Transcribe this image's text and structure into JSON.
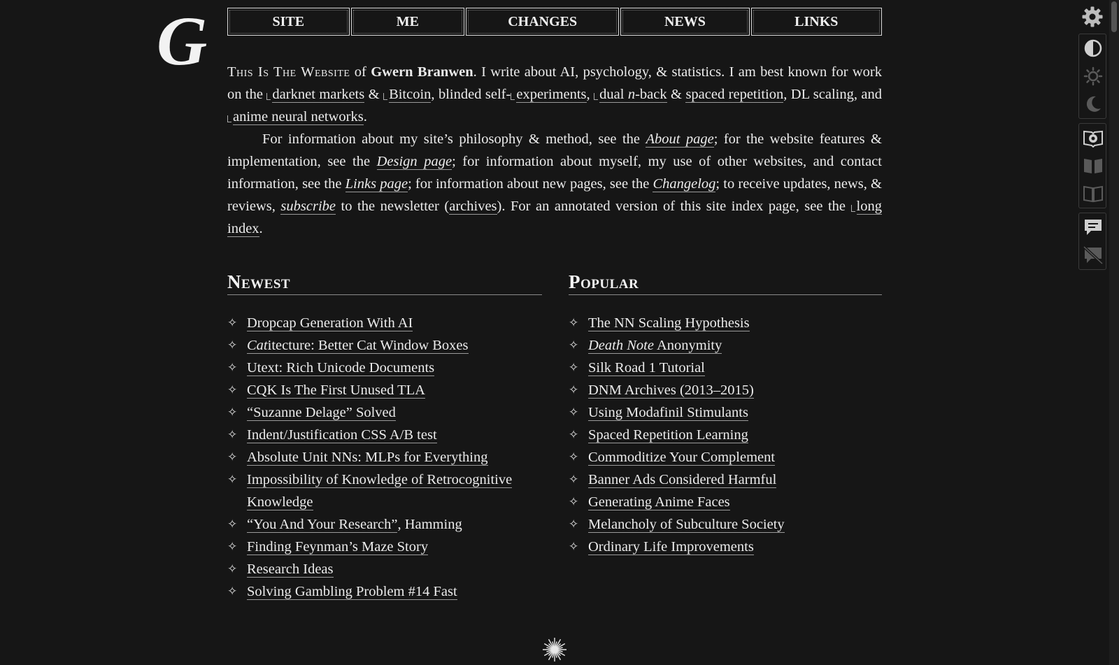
{
  "nav": [
    "SITE",
    "ME",
    "CHANGES",
    "NEWS",
    "LINKS"
  ],
  "intro": {
    "sc_title": "This Is The Website",
    "of": " of ",
    "author": "Gwern Branwen",
    "s1": ". I write about AI, psychology, & statistics. I am best known for work on the ",
    "link_darknet": "darknet markets",
    "amp1": " & ",
    "link_bitcoin": "Bitcoin",
    "s2": ", blinded self-",
    "link_experiments": "experiments",
    "comma1": ", ",
    "link_dualnback_a": "dual ",
    "link_dualnback_n": "n",
    "link_dualnback_b": "-back",
    "amp2": " & ",
    "link_spaced": "spaced repetition",
    "s3": ", DL scaling, and ",
    "link_anime": "anime neural networks",
    "s4": ".",
    "p2_a": "For information about my site’s philosophy & method, see the ",
    "link_about": "About page",
    "p2_b": "; for the website features & implementation, see the ",
    "link_design": "Design page",
    "p2_c": "; for information about myself, my use of other websites, and contact information, see the ",
    "link_links": "Links page",
    "p2_d": "; for information about new pages, see the ",
    "link_changelog": "Changelog",
    "p2_e": "; to receive updates, news, & reviews, ",
    "link_subscribe": "subscribe",
    "p2_f": " to the newsletter (",
    "link_archives": "archives",
    "p2_g": "). For an annotated version of this site index page, see the ",
    "link_longindex": "long index",
    "p2_h": "."
  },
  "newest": {
    "heading": "Newest",
    "items": [
      {
        "pre": "",
        "label": "Dropcap Generation With AI",
        "post": ""
      },
      {
        "pre_italic": "Cat",
        "label": "itecture: Better Cat Window Boxes",
        "post": ""
      },
      {
        "label": "Utext: Rich Unicode Documents",
        "post": ""
      },
      {
        "label": "CQK Is The First Unused TLA",
        "post": ""
      },
      {
        "label": "“Suzanne Delage” Solved",
        "post": ""
      },
      {
        "label": "Indent/Justification CSS A/B test",
        "post": ""
      },
      {
        "label": "Absolute Unit NNs: MLPs for Everything",
        "post": ""
      },
      {
        "label": "Impossibility of Knowledge of Retrocognitive Knowledge",
        "post": ""
      },
      {
        "label": "“You And Your Research”",
        "post": ", Hamming"
      },
      {
        "label": "Finding Feynman’s Maze Story",
        "post": ""
      },
      {
        "label": "Research Ideas",
        "post": ""
      },
      {
        "label": "Solving Gambling Problem #14 Fast",
        "post": ""
      }
    ]
  },
  "popular": {
    "heading": "Popular",
    "items": [
      {
        "label": "The NN Scaling Hypothesis"
      },
      {
        "pre_italic": "Death Note",
        "label": " Anonymity"
      },
      {
        "label": "Silk Road 1 Tutorial"
      },
      {
        "label": "DNM Archives (2013–2015)"
      },
      {
        "label": "Using Modafinil Stimulants"
      },
      {
        "label": "Spaced Repetition Learning"
      },
      {
        "label": "Commoditize Your Complement"
      },
      {
        "label": "Banner Ads Considered Harmful"
      },
      {
        "label": "Generating Anime Faces"
      },
      {
        "label": "Melancholy of Subculture Society"
      },
      {
        "label": "Ordinary Life Improvements"
      }
    ]
  },
  "bullet_glyph": "✧",
  "logo_letter": "G",
  "toolbar_icons": [
    "gear-icon",
    "contrast-icon",
    "sun-icon",
    "moon-icon",
    "reader-settings-icon",
    "book-filled-icon",
    "book-open-icon",
    "comment-icon",
    "comment-off-icon"
  ],
  "colors": {
    "background": "#161616",
    "text": "#ececec",
    "accent": "#9a9a9a"
  }
}
